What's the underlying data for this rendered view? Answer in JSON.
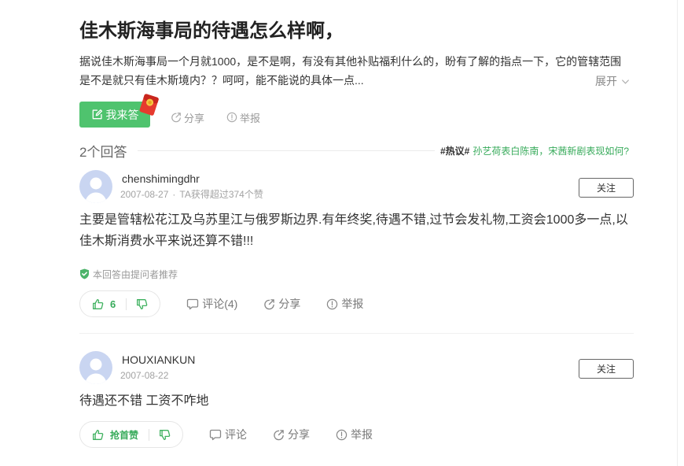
{
  "question": {
    "title": "佳木斯海事局的待遇怎么样啊，",
    "description": "据说佳木斯海事局一个月就1000，是不是啊，有没有其他补贴福利什么的，盼有了解的指点一下，它的管辖范围是不是就只有佳木斯境内？？呵呵，能不能说的具体一点...",
    "expand_label": "展开",
    "actions": {
      "answer_label": "我来答",
      "share_label": "分享",
      "report_label": "举报"
    }
  },
  "answers_header": {
    "count_label": "2个回答",
    "hot_tag": "#热议#",
    "hot_topic": "孙艺荷表白陈南，宋茜新剧表现如何?"
  },
  "answers": [
    {
      "username": "chenshimingdhr",
      "date": "2007-08-27",
      "meta_separator": "·",
      "meta": "TA获得超过374个赞",
      "follow_label": "关注",
      "content": "主要是管辖松花江及乌苏里江与俄罗斯边界.有年终奖,待遇不错,过节会发礼物,工资会1000多一点,以佳木斯消费水平来说还算不错!!!",
      "recommend_label": "本回答由提问者推荐",
      "vote_label": "6",
      "comment_label": "评论(4)",
      "share_label": "分享",
      "report_label": "举报"
    },
    {
      "username": "HOUXIANKUN",
      "date": "2007-08-22",
      "follow_label": "关注",
      "content": "待遇还不错 工资不咋地",
      "vote_label": "抢首赞",
      "comment_label": "评论",
      "share_label": "分享",
      "report_label": "举报"
    }
  ],
  "colors": {
    "brand_green": "#4fc36e",
    "text_green": "#38ab5b",
    "text_primary": "#333333",
    "text_muted": "#999999",
    "red_envelope": "#e63a2e"
  },
  "icons": {
    "answer_button": "edit-icon",
    "answer_badge": "red-envelope-icon",
    "share": "share-icon",
    "report": "report-icon",
    "expand": "chevron-down-icon",
    "recommend": "shield-check-icon",
    "upvote": "thumbs-up-icon",
    "downvote": "thumbs-down-icon",
    "comment": "comment-icon",
    "avatar": "default-avatar-icon"
  }
}
